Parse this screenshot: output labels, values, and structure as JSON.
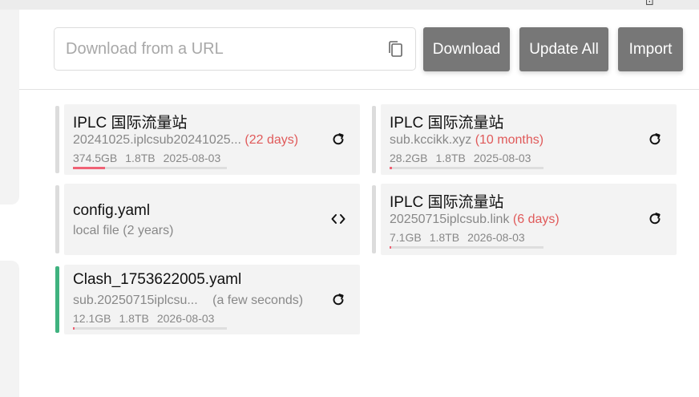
{
  "toolbar": {
    "url_placeholder": "Download from a URL",
    "url_value": "",
    "download_label": "Download",
    "update_all_label": "Update All",
    "import_label": "Import"
  },
  "cards": [
    {
      "title": "IPLC 国际流量站",
      "source": "20241025.iplcsub20241025...",
      "age": "(22 days)",
      "age_status": "red",
      "used": "374.5GB",
      "total": "1.8TB",
      "expire": "2025-08-03",
      "usage_fraction": 0.21,
      "action_icon": "refresh-icon"
    },
    {
      "title": "IPLC 国际流量站",
      "source": "sub.kccikk.xyz",
      "age": "(10 months)",
      "age_status": "red",
      "used": "28.2GB",
      "total": "1.8TB",
      "expire": "2025-08-03",
      "usage_fraction": 0.016,
      "action_icon": "refresh-icon"
    },
    {
      "title": "config.yaml",
      "source": "local file",
      "age": "(2 years)",
      "age_status": "gray",
      "action_icon": "code-icon"
    },
    {
      "title": "IPLC 国际流量站",
      "source": "20250715iplcsub.link",
      "age": "(6 days)",
      "age_status": "red",
      "used": "7.1GB",
      "total": "1.8TB",
      "expire": "2026-08-03",
      "usage_fraction": 0.004,
      "action_icon": "refresh-icon"
    },
    {
      "title": "Clash_1753622005.yaml",
      "source": "sub.20250715iplcsu...",
      "age": "(a few seconds)",
      "age_status": "gray",
      "used": "12.1GB",
      "total": "1.8TB",
      "expire": "2026-08-03",
      "usage_fraction": 0.007,
      "action_icon": "refresh-icon",
      "active": true
    }
  ],
  "colors": {
    "button_bg": "#777777",
    "active_bar": "#3fb27f",
    "progress_fill": "#f06275",
    "age_red": "#e05a5a"
  }
}
